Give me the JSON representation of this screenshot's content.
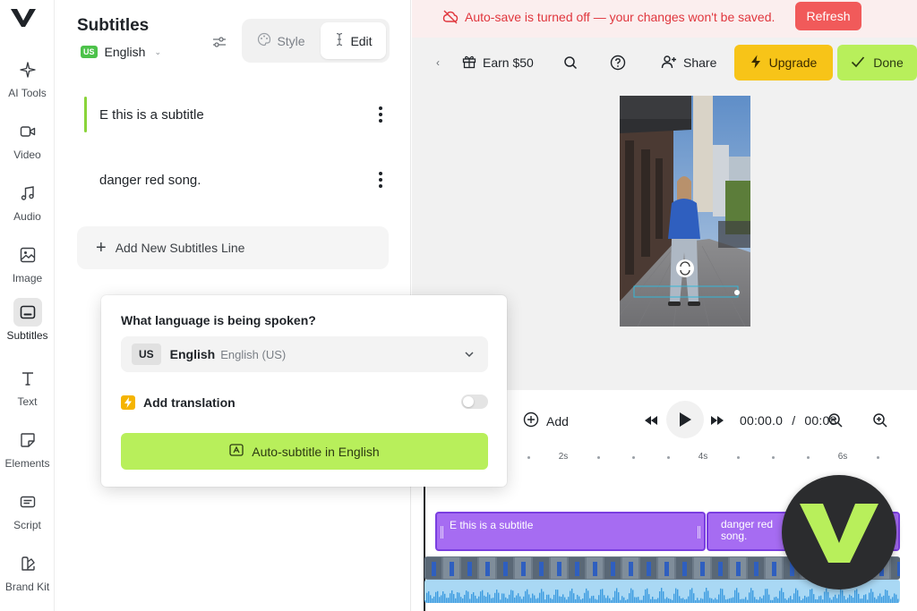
{
  "rail": {
    "items": [
      {
        "label": "AI Tools",
        "icon": "sparkle-icon"
      },
      {
        "label": "Video",
        "icon": "video-camera-icon"
      },
      {
        "label": "Audio",
        "icon": "music-note-icon"
      },
      {
        "label": "Image",
        "icon": "image-icon"
      },
      {
        "label": "Subtitles",
        "icon": "subtitles-icon",
        "active": true
      },
      {
        "label": "Text",
        "icon": "text-icon"
      },
      {
        "label": "Elements",
        "icon": "elements-icon"
      },
      {
        "label": "Script",
        "icon": "script-icon"
      },
      {
        "label": "Brand Kit",
        "icon": "brand-kit-icon"
      }
    ]
  },
  "panel": {
    "title": "Subtitles",
    "language_badge": "US",
    "language_name": "English",
    "tabs": {
      "style": "Style",
      "edit": "Edit"
    },
    "lines": [
      "E this is a subtitle",
      "danger red song."
    ],
    "add_line": "Add New Subtitles Line"
  },
  "popup": {
    "question": "What language is being spoken?",
    "select_code": "US",
    "select_main": "English",
    "select_sub": "English (US)",
    "translation_label": "Add translation",
    "translation_enabled": false,
    "auto_button": "Auto-subtitle in English"
  },
  "banner": {
    "text": "Auto-save is turned off — your changes won't be saved.",
    "refresh": "Refresh"
  },
  "toolbar": {
    "earn": "Earn $50",
    "share": "Share",
    "upgrade": "Upgrade",
    "done": "Done"
  },
  "timeline": {
    "add": "Add",
    "current_time": "00:00.0",
    "separator": "/",
    "total_time": "00:08",
    "ruler_labels": [
      "2s",
      "4s",
      "6s"
    ],
    "clips": [
      "E this is a subtitle",
      "danger red song."
    ]
  },
  "colors": {
    "accent_green": "#b8ef5b",
    "upgrade_yellow": "#f7c418",
    "warning_red": "#e0363d",
    "clip_purple": "#a66cf2"
  }
}
